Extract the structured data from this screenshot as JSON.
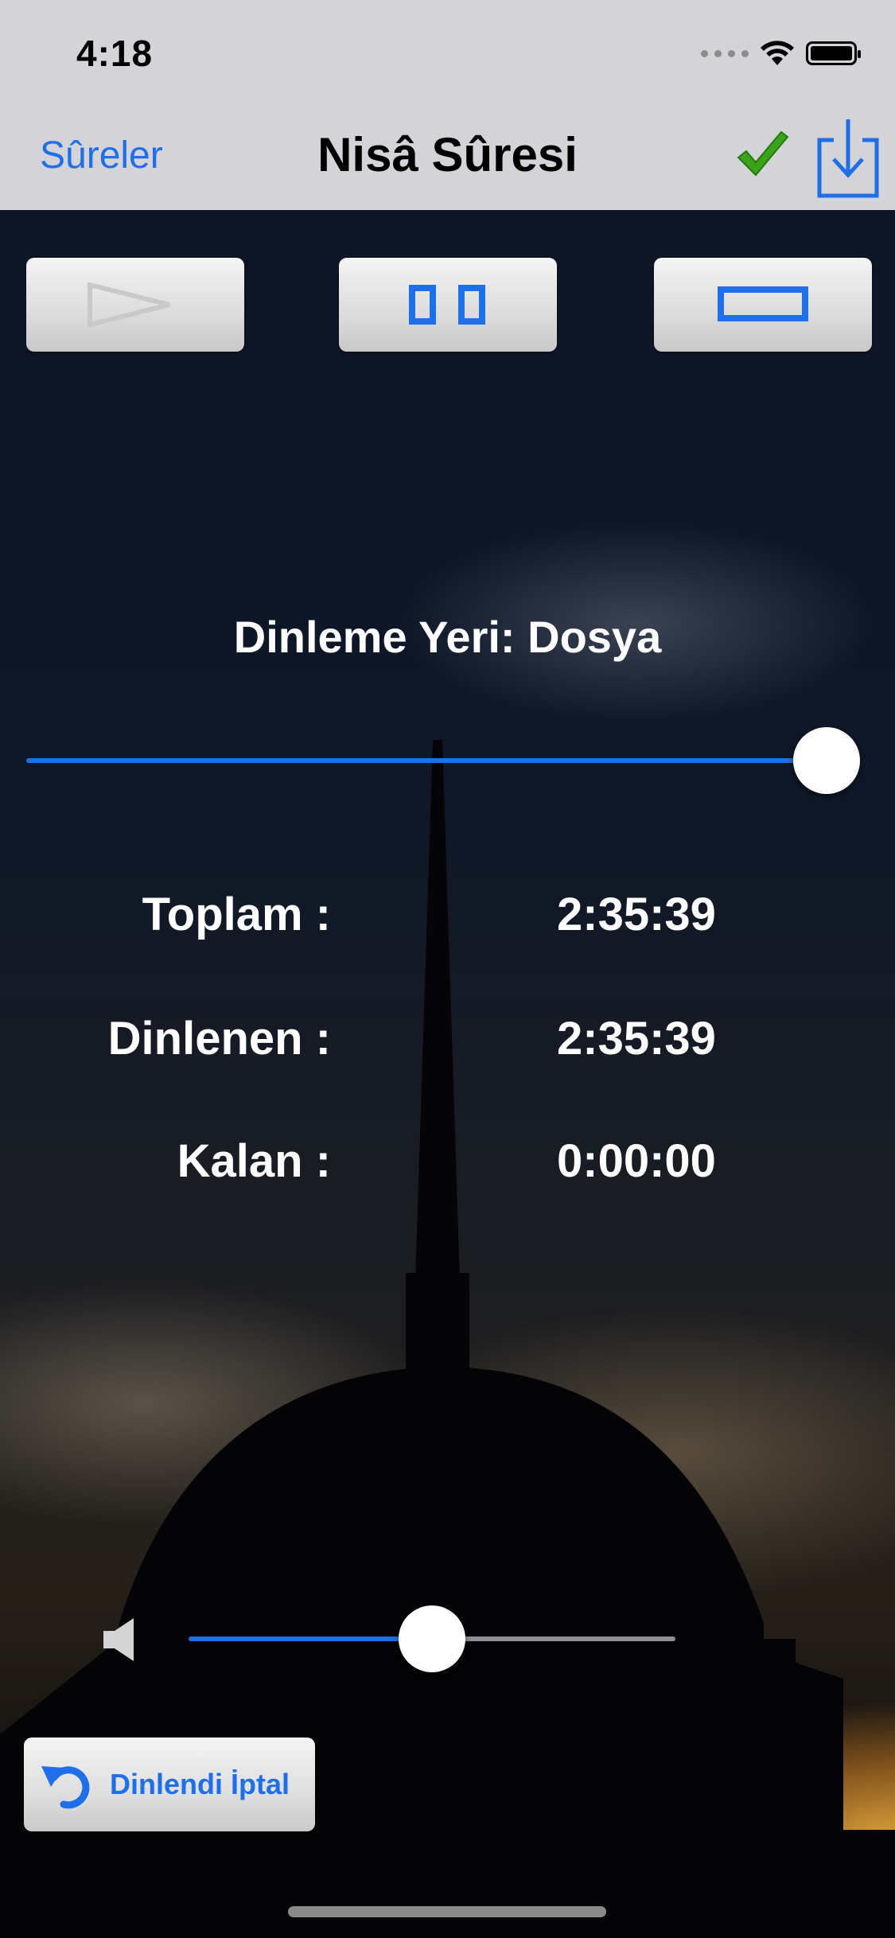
{
  "status_bar": {
    "time": "4:18"
  },
  "nav": {
    "back_label": "Sûreler",
    "title": "Nisâ Sûresi"
  },
  "controls": {
    "play": "play",
    "pause": "pause",
    "stop": "stop"
  },
  "player": {
    "listen_place": "Dinleme Yeri: Dosya",
    "progress_fraction": 1.0,
    "rows": [
      {
        "label": "Toplam :",
        "value": "2:35:39"
      },
      {
        "label": "Dinlenen :",
        "value": "2:35:39"
      },
      {
        "label": "Kalan :",
        "value": "0:00:00"
      }
    ],
    "volume_fraction": 0.5
  },
  "undo_button": {
    "label": "Dinlendi İptal"
  },
  "colors": {
    "accent": "#1f6fe8",
    "nav_bar": "#d3d3d8",
    "check": "#3aa31a"
  }
}
